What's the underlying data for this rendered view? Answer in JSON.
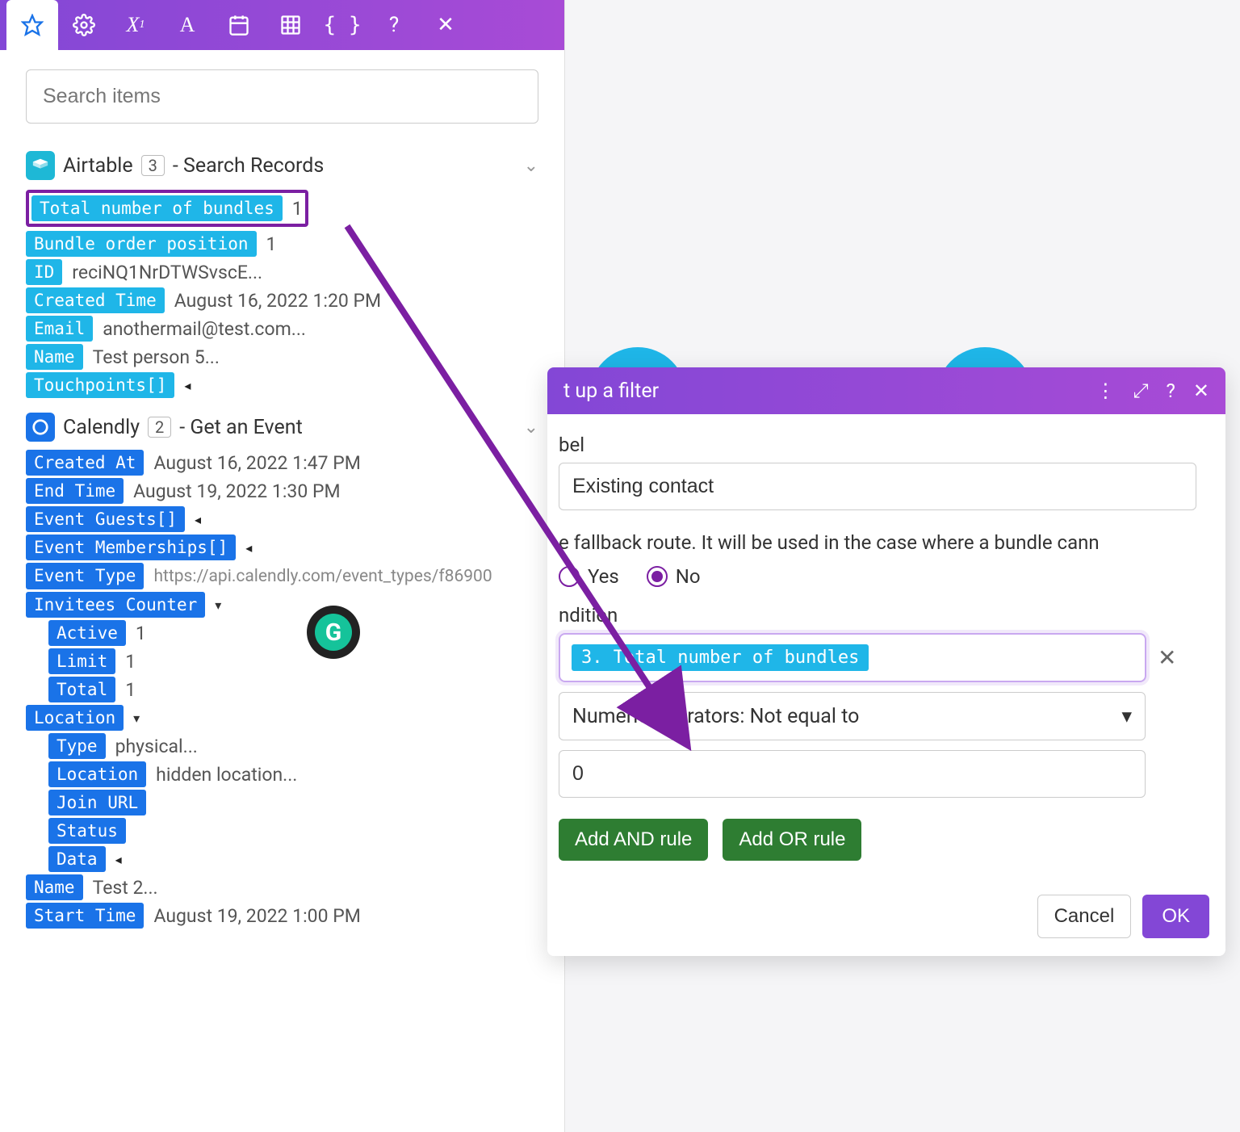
{
  "search": {
    "placeholder": "Search items"
  },
  "airtable": {
    "name": "Airtable",
    "badge": "3",
    "suffix": "- Search Records",
    "fields": {
      "total_bundles": {
        "label": "Total number of bundles",
        "value": "1"
      },
      "bundle_pos": {
        "label": "Bundle order position",
        "value": "1"
      },
      "id": {
        "label": "ID",
        "value": "reciNQ1NrDTWSvscE..."
      },
      "created": {
        "label": "Created Time",
        "value": "August 16, 2022 1:20 PM"
      },
      "email": {
        "label": "Email",
        "value": "anothermail@test.com..."
      },
      "name": {
        "label": "Name",
        "value": "Test person 5..."
      },
      "touchpoints": {
        "label": "Touchpoints[]"
      }
    }
  },
  "calendly": {
    "name": "Calendly",
    "badge": "2",
    "suffix": "- Get an Event",
    "fields": {
      "created_at": {
        "label": "Created At",
        "value": "August 16, 2022 1:47 PM"
      },
      "end_time": {
        "label": "End Time",
        "value": "August 19, 2022 1:30 PM"
      },
      "event_guests": {
        "label": "Event Guests[]"
      },
      "event_mem": {
        "label": "Event Memberships[]"
      },
      "event_type": {
        "label": "Event Type",
        "value": "https://api.calendly.com/event_types/f86900"
      },
      "invitees": {
        "label": "Invitees Counter"
      },
      "active": {
        "label": "Active",
        "value": "1"
      },
      "limit": {
        "label": "Limit",
        "value": "1"
      },
      "total": {
        "label": "Total",
        "value": "1"
      },
      "location": {
        "label": "Location"
      },
      "loc_type": {
        "label": "Type",
        "value": "physical..."
      },
      "loc_loc": {
        "label": "Location",
        "value": "hidden location..."
      },
      "join_url": {
        "label": "Join URL"
      },
      "status": {
        "label": "Status"
      },
      "data": {
        "label": "Data"
      },
      "cname": {
        "label": "Name",
        "value": "Test 2..."
      },
      "start_time": {
        "label": "Start Time",
        "value": "August 19, 2022 1:00 PM"
      }
    }
  },
  "modal": {
    "title": "t up a filter",
    "label_label": "bel",
    "label_value": "Existing contact",
    "fallback_text": "e fallback route. It will be used in the case where a bundle cann",
    "radio_yes": "Yes",
    "radio_no": "No",
    "condition_label": "ndition",
    "condition_pill": "3. Total number of bundles",
    "operator": "Numeric operators: Not equal to",
    "value": "0",
    "add_and": "Add AND rule",
    "add_or": "Add OR rule",
    "cancel": "Cancel",
    "ok": "OK"
  }
}
